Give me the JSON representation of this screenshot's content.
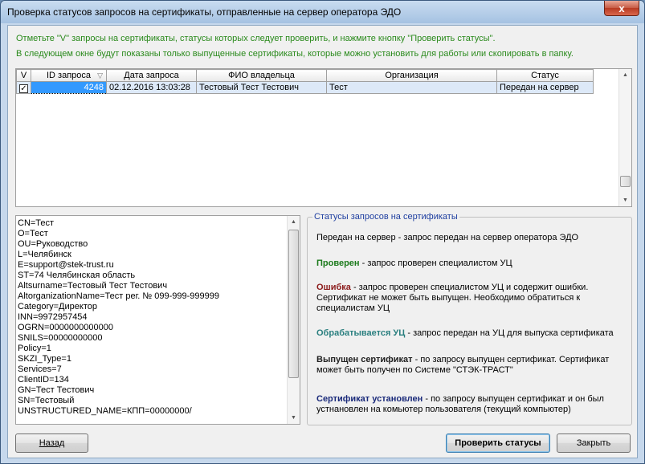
{
  "window": {
    "title": "Проверка статусов запросов на сертификаты, отправленные на сервер оператора ЭДО",
    "close_glyph": "x"
  },
  "hints": [
    "Отметьте \"V\" запросы на сертификаты, статусы которых следует проверить, и нажмите кнопку \"Проверить статусы\".",
    "В следующем окне будут показаны только выпущенные сертификаты, которые можно установить для работы или скопировать в папку."
  ],
  "grid": {
    "columns": [
      "V",
      "ID запроса",
      "Дата запроса",
      "ФИО владельца",
      "Организация",
      "Статус"
    ],
    "rows": [
      {
        "checked": "✓",
        "id": "4248",
        "date": "02.12.2016 13:03:28",
        "owner": "Тестовый Тест Тестович",
        "org": "Тест",
        "status": "Передан на сервер"
      }
    ]
  },
  "details": [
    "CN=Тест",
    "O=Тест",
    "OU=Руководство",
    "L=Челябинск",
    "E=support@stek-trust.ru",
    "ST=74 Челябинская область",
    "Altsurname=Тестовый Тест Тестович",
    "AltorganizationName=Тест рег. № 099-999-999999",
    "Category=Директор",
    "INN=9972957454",
    "OGRN=0000000000000",
    "SNILS=00000000000",
    "Policy=1",
    "SKZI_Type=1",
    "Services=7",
    "ClientID=134",
    "GN=Тест Тестович",
    "SN=Тестовый",
    "UNSTRUCTURED_NAME=КПП=00000000/"
  ],
  "legend": {
    "title": "Статусы запросов на сертификаты",
    "items": [
      {
        "label": "Передан на сервер",
        "color": "#000000",
        "bold": false,
        "text": "  - запрос передан на сервер оператора ЭДО"
      },
      {
        "label": "Проверен",
        "color": "#1b7a1b",
        "bold": true,
        "text": "   - запрос проверен специалистом УЦ"
      },
      {
        "label": "Ошибка",
        "color": "#8b1a1a",
        "bold": true,
        "text": " - запрос проверен специалистом УЦ и содержит ошибки. Сертификат не может быть выпущен. Необходимо  обратиться к специалистам УЦ"
      },
      {
        "label": "Обрабатывается УЦ",
        "color": "#2a7f7f",
        "bold": true,
        "text": " - запрос передан на УЦ для выпуска сертификата"
      },
      {
        "label": "Выпущен сертификат",
        "color": "#202020",
        "bold": true,
        "text": " - по запросу выпущен сертификат. Сертификат может быть получен по Системе \"СТЭК-ТРАСТ\""
      },
      {
        "label": "Сертификат установлен",
        "color": "#1a2a7a",
        "bold": true,
        "text": " - по запросу выпущен сертификат и он был устнановлен на комьютер пользователя (текущий компьютер)"
      }
    ]
  },
  "buttons": {
    "back": "Назад",
    "check": "Проверить статусы",
    "close": "Закрыть"
  }
}
